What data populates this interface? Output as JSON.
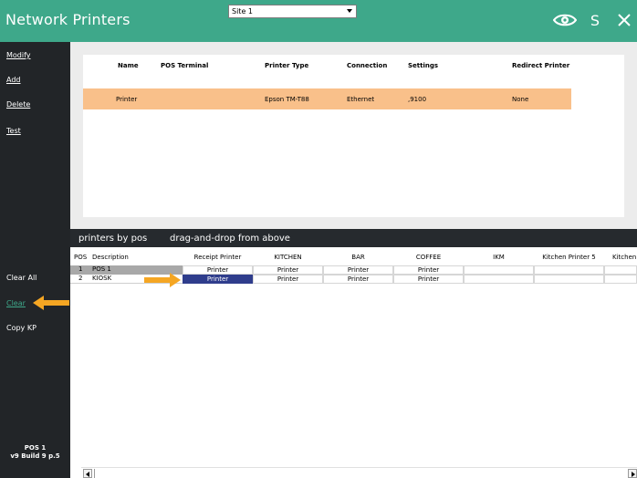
{
  "header": {
    "title": "Network Printers",
    "site_selected": "Site 1",
    "s_label": "S",
    "accent": "#3ea88a"
  },
  "sidebar": {
    "modify": "Modify",
    "add": "Add",
    "delete": "Delete",
    "test": "Test",
    "clear_all": "Clear All",
    "clear": "Clear",
    "copy_kp": "Copy KP",
    "pos_name": "POS 1",
    "version": "v9 Build 9 p.5"
  },
  "printers_table": {
    "columns": [
      "Name",
      "POS Terminal",
      "Printer Type",
      "Connection",
      "Settings",
      "Redirect Printer"
    ],
    "rows": [
      {
        "name": "Printer",
        "pos_terminal": "",
        "printer_type": "Epson TM-T88",
        "connection": "Ethernet",
        "settings": ",9100",
        "redirect_printer": "None"
      }
    ],
    "selected_row_color": "#f9c08a"
  },
  "strip": {
    "tab_label": "printers by pos",
    "hint": "drag-and-drop from above"
  },
  "pos_grid": {
    "columns": [
      "POS",
      "Description",
      "Receipt Printer",
      "KITCHEN",
      "BAR",
      "COFFEE",
      "IKM",
      "Kitchen Printer 5",
      "Kitchen"
    ],
    "rows": [
      {
        "pos": "1",
        "description": "POS 1",
        "receipt": "Printer",
        "kitchen": "Printer",
        "bar": "Printer",
        "coffee": "Printer"
      },
      {
        "pos": "2",
        "description": "KIOSK",
        "receipt": "Printer",
        "kitchen": "Printer",
        "bar": "Printer",
        "coffee": "Printer"
      }
    ]
  },
  "annotation_color": "#f5a623",
  "icons": [
    "eye-icon",
    "close-icon",
    "chevron-down-icon",
    "arrow-left-icon",
    "arrow-right-icon"
  ]
}
